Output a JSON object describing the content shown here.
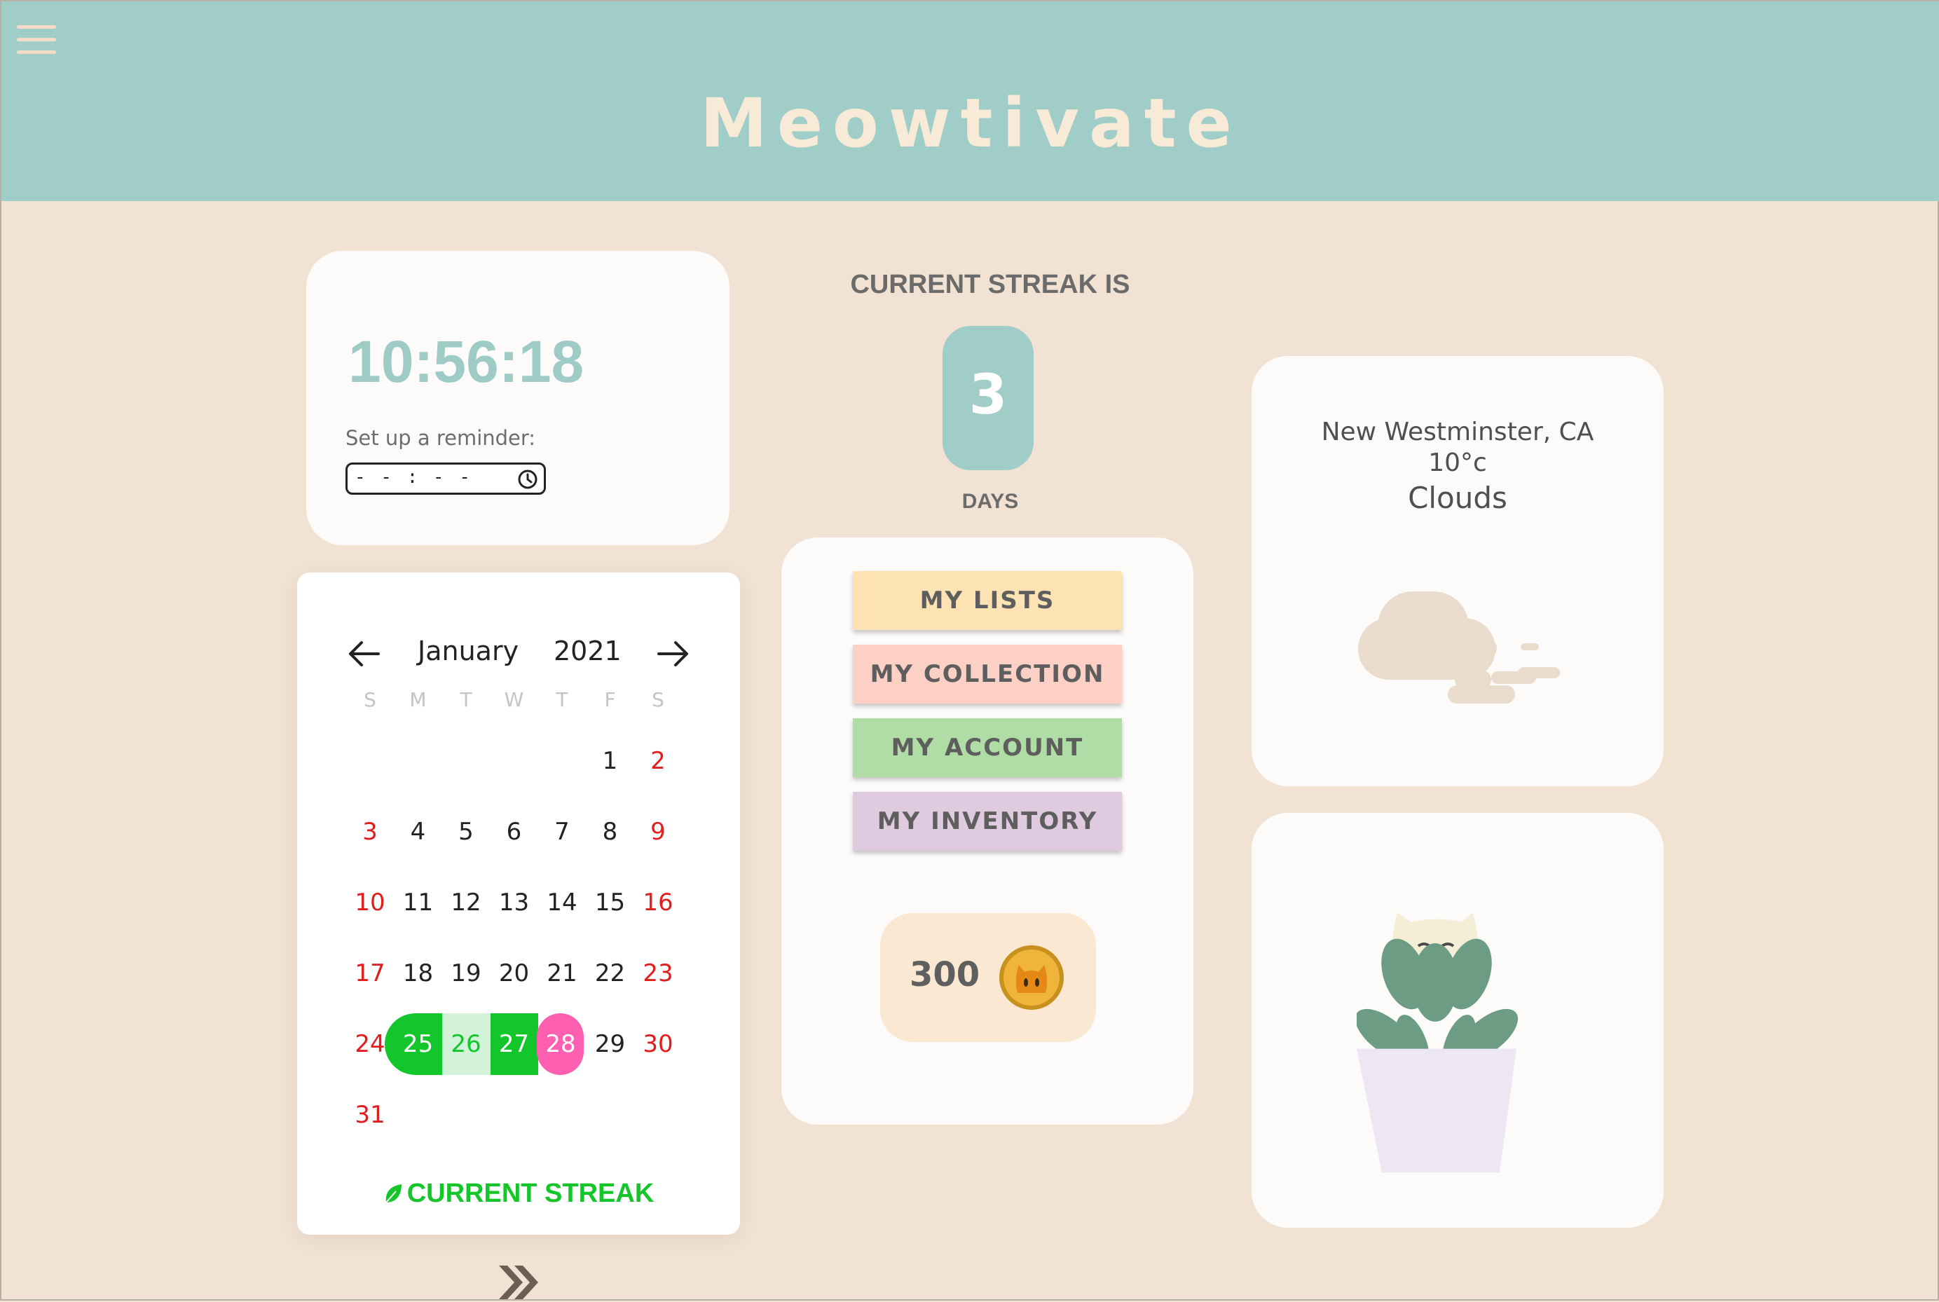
{
  "header": {
    "title": "Meowtivate",
    "menu_icon": "hamburger-menu-icon"
  },
  "clock": {
    "time": "10:56:18",
    "reminder_label": "Set up a reminder:",
    "reminder_placeholder": "- - : - -"
  },
  "calendar": {
    "month": "January",
    "year": "2021",
    "weekdays": [
      "S",
      "M",
      "T",
      "W",
      "T",
      "F",
      "S"
    ],
    "weeks": [
      [
        "",
        "",
        "",
        "",
        "",
        "1",
        "2"
      ],
      [
        "3",
        "4",
        "5",
        "6",
        "7",
        "8",
        "9"
      ],
      [
        "10",
        "11",
        "12",
        "13",
        "14",
        "15",
        "16"
      ],
      [
        "17",
        "18",
        "19",
        "20",
        "21",
        "22",
        "23"
      ],
      [
        "24",
        "25",
        "26",
        "27",
        "28",
        "29",
        "30"
      ],
      [
        "31",
        "",
        "",
        "",
        "",
        "",
        ""
      ]
    ],
    "streak_days": [
      "25",
      "26",
      "27"
    ],
    "today": "28",
    "legend": "CURRENT STREAK",
    "colors": {
      "streak": "#12c62c",
      "streak_light": "#d3f2da",
      "today": "#ff5fb1",
      "weekend": "#e11e1e"
    }
  },
  "streak": {
    "title": "CURRENT STREAK IS",
    "value": "3",
    "unit": "DAYS"
  },
  "menu": {
    "items": [
      {
        "label": "MY LISTS",
        "color": "#fde3b3"
      },
      {
        "label": "MY COLLECTION",
        "color": "#fdd0c6"
      },
      {
        "label": "MY ACCOUNT",
        "color": "#b0dda6"
      },
      {
        "label": "MY INVENTORY",
        "color": "#e0cadf"
      }
    ],
    "coins": "300",
    "coin_icon": "cat-coin-icon"
  },
  "weather": {
    "city": "New Westminster, CA",
    "temp": "10°c",
    "condition": "Clouds",
    "icon": "clouds-icon"
  },
  "plant": {
    "icon": "potted-succulent-cat-icon"
  }
}
